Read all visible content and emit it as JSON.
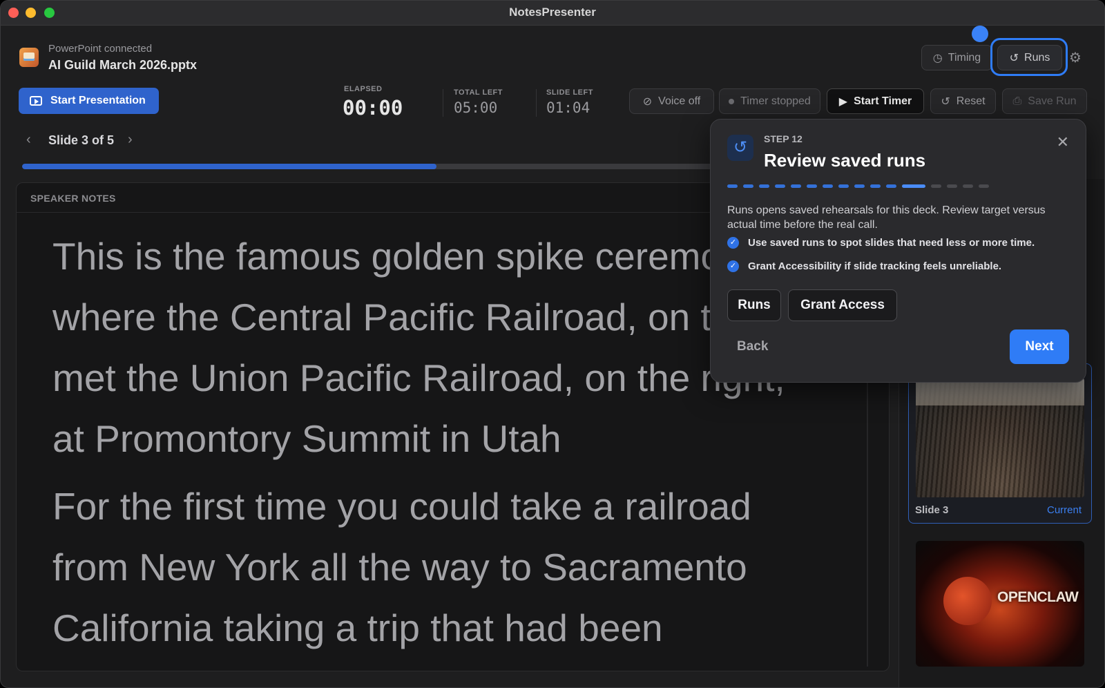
{
  "window": {
    "title": "NotesPresenter"
  },
  "header": {
    "connection_status": "PowerPoint connected",
    "deck_name": "AI Guild March 2026.pptx",
    "timing_label": "Timing",
    "runs_label": "Runs"
  },
  "toolbar": {
    "start_presentation": "Start Presentation",
    "elapsed_label": "ELAPSED",
    "elapsed_value": "00:00",
    "total_left_label": "TOTAL LEFT",
    "total_left_value": "05:00",
    "slide_left_label": "SLIDE LEFT",
    "slide_left_value": "01:04",
    "voice_label": "Voice off",
    "timer_status": "Timer stopped",
    "start_timer": "Start Timer",
    "reset_label": "Reset",
    "save_run": "Save Run"
  },
  "slide_nav": {
    "label": "Slide 3 of 5",
    "progress_fraction": 0.6
  },
  "notes": {
    "title": "SPEAKER NOTES",
    "paragraphs": [
      "This is the famous golden spike ceremony where the Central Pacific Railroad, on the left, met the Union Pacific Railroad, on the right, at Promontory Summit in Utah",
      "For the first time you could take a railroad from New York all the way to Sacramento California taking a trip that had been"
    ]
  },
  "sidebar": {
    "current_slide_label": "Slide 3",
    "current_badge": "Current",
    "next_thumb_logo": "OPENCLAW"
  },
  "tour": {
    "step": "STEP 12",
    "title": "Review saved runs",
    "total_steps": 16,
    "current_step": 12,
    "description": "Runs opens saved rehearsals for this deck. Review target versus actual time before the real call.",
    "checks": [
      "Use saved runs to spot slides that need less or more time.",
      "Grant Accessibility if slide tracking feels unreliable."
    ],
    "runs_button": "Runs",
    "grant_button": "Grant Access",
    "back_label": "Back",
    "next_label": "Next"
  },
  "colors": {
    "accent": "#2f7cf6",
    "primary_button": "#2f63cc",
    "background": "#1e1e1f"
  },
  "icons": {
    "timing": "clock-icon",
    "runs": "history-icon",
    "settings": "gear-icon",
    "voice": "microphone-off-icon",
    "reset": "reset-icon",
    "save": "save-icon",
    "close": "close-icon"
  }
}
